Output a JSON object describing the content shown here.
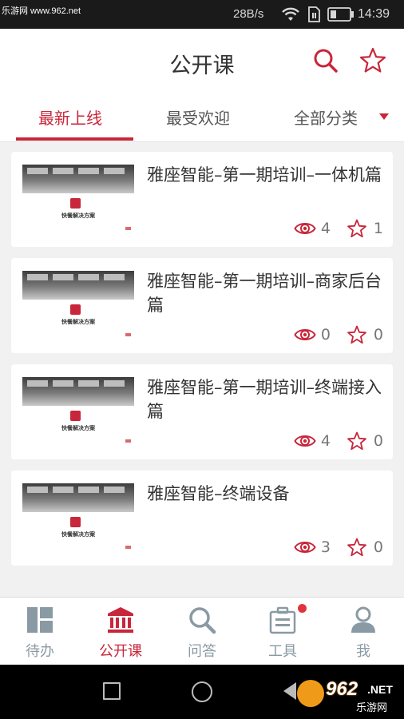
{
  "status_bar": {
    "watermark": "乐游网 www.962.net",
    "net_speed": "28B/s",
    "time": "14:39"
  },
  "header": {
    "title": "公开课",
    "search_icon": "search-icon",
    "favorite_icon": "star-icon"
  },
  "tabs": [
    {
      "label": "最新上线",
      "active": true
    },
    {
      "label": "最受欢迎",
      "active": false
    },
    {
      "label": "全部分类",
      "active": false
    }
  ],
  "courses": [
    {
      "title": "雅座智能–第一期培训–一体机篇",
      "thumb_caption": "快餐解决方案",
      "views": "4",
      "favorites": "1"
    },
    {
      "title": "雅座智能–第一期培训–商家后台篇",
      "thumb_caption": "快餐解决方案",
      "views": "0",
      "favorites": "0"
    },
    {
      "title": "雅座智能–第一期培训–终端接入篇",
      "thumb_caption": "快餐解决方案",
      "views": "4",
      "favorites": "0"
    },
    {
      "title": "雅座智能–终端设备",
      "thumb_caption": "快餐解决方案",
      "views": "3",
      "favorites": "0"
    }
  ],
  "bottom_nav": [
    {
      "label": "待办",
      "icon": "dashboard-icon",
      "active": false
    },
    {
      "label": "公开课",
      "icon": "institution-icon",
      "active": true
    },
    {
      "label": "问答",
      "icon": "search-icon",
      "active": false
    },
    {
      "label": "工具",
      "icon": "toolbox-icon",
      "active": false,
      "badge": true
    },
    {
      "label": "我",
      "icon": "user-icon",
      "active": false
    }
  ],
  "watermark_logo": {
    "number": "962",
    "suffix": ".NET",
    "site": "乐游网"
  },
  "colors": {
    "accent": "#c8263a",
    "nav_inactive": "#8a9aa4",
    "badge": "#e0333a"
  }
}
